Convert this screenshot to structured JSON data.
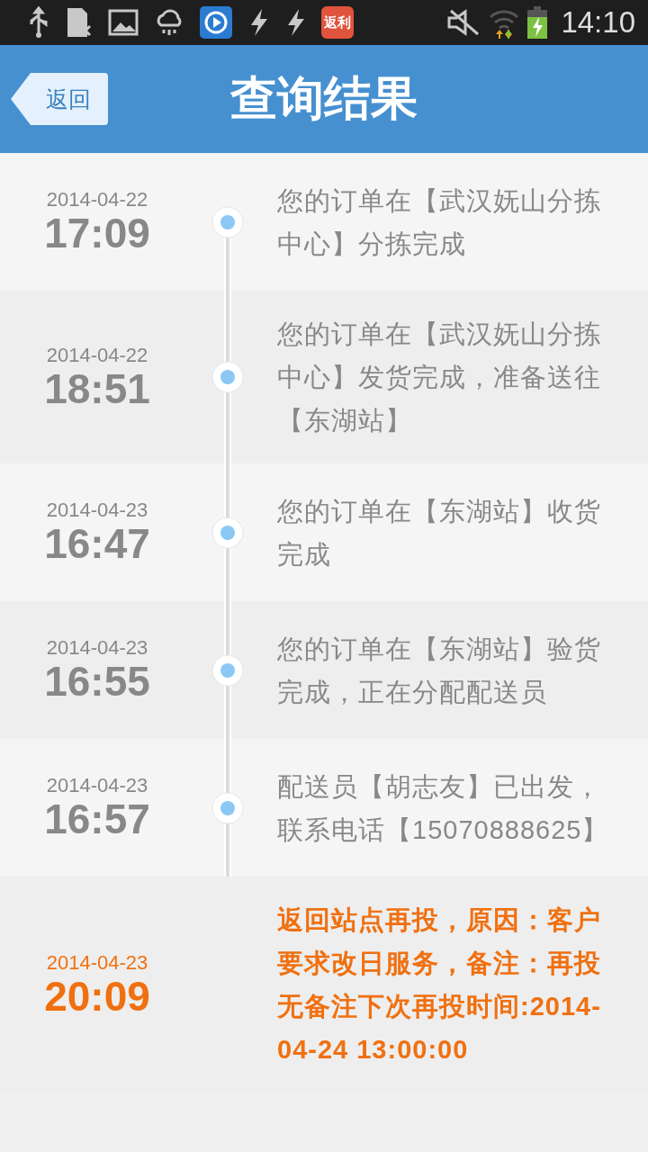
{
  "status_bar": {
    "app_badge": "返利",
    "time": "14:10"
  },
  "header": {
    "back_button": "返回",
    "title": "查询结果"
  },
  "timeline": [
    {
      "date": "2014-04-22",
      "time": "17:09",
      "message": "您的订单在【武汉妩山分拣中心】分拣完成",
      "highlighted": false
    },
    {
      "date": "2014-04-22",
      "time": "18:51",
      "message": "您的订单在【武汉妩山分拣中心】发货完成，准备送往【东湖站】",
      "highlighted": false
    },
    {
      "date": "2014-04-23",
      "time": "16:47",
      "message": "您的订单在【东湖站】收货完成",
      "highlighted": false
    },
    {
      "date": "2014-04-23",
      "time": "16:55",
      "message": "您的订单在【东湖站】验货完成，正在分配配送员",
      "highlighted": false
    },
    {
      "date": "2014-04-23",
      "time": "16:57",
      "message": "配送员【胡志友】已出发，联系电话【15070888625】",
      "highlighted": false
    },
    {
      "date": "2014-04-23",
      "time": "20:09",
      "message": "返回站点再投，原因：客户要求改日服务，备注：再投无备注下次再投时间:2014-04-24 13:00:00",
      "highlighted": true
    }
  ]
}
